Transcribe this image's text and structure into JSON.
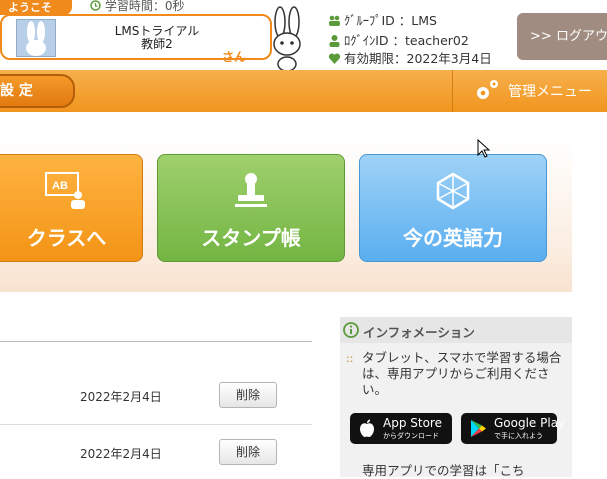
{
  "header": {
    "welcome": "ようこそ",
    "study_time": "学習時間：0秒",
    "user_name": "LMSトライアル",
    "user_role": "教師2",
    "honorific": "さん",
    "group_id": "ｸﾞﾙｰﾌﾟID ：LMS",
    "login_id": "ﾛｸﾞｲﾝID ：teacher02",
    "expiry": "有効期限：2022年3月4日",
    "logout": "ログアウト",
    "logout_prefix": ">>"
  },
  "nav": {
    "settings": "設 定",
    "admin_menu": "管理メニュー"
  },
  "tiles": [
    {
      "label": "クラスへ",
      "icon": "class-icon"
    },
    {
      "label": "スタンプ帳",
      "icon": "stamp-icon"
    },
    {
      "label": "今の英語力",
      "icon": "globe-icon"
    }
  ],
  "list": {
    "rows": [
      {
        "date": "2022年2月4日",
        "action": "削除"
      },
      {
        "date": "2022年2月4日",
        "action": "削除"
      }
    ]
  },
  "info": {
    "title": "インフォメーション",
    "text": "タブレット、スマホで学習する場合は、専用アプリからご利用ください。",
    "app_store_big": "App Store",
    "app_store_small": "からダウンロード",
    "google_play_big": "Google Play",
    "google_play_small": "で手に入れよう",
    "more": "専用アプリでの学習は「こち"
  },
  "colors": {
    "accent": "#f08a1c",
    "stamp": "#73b543",
    "english": "#5aaef0"
  }
}
